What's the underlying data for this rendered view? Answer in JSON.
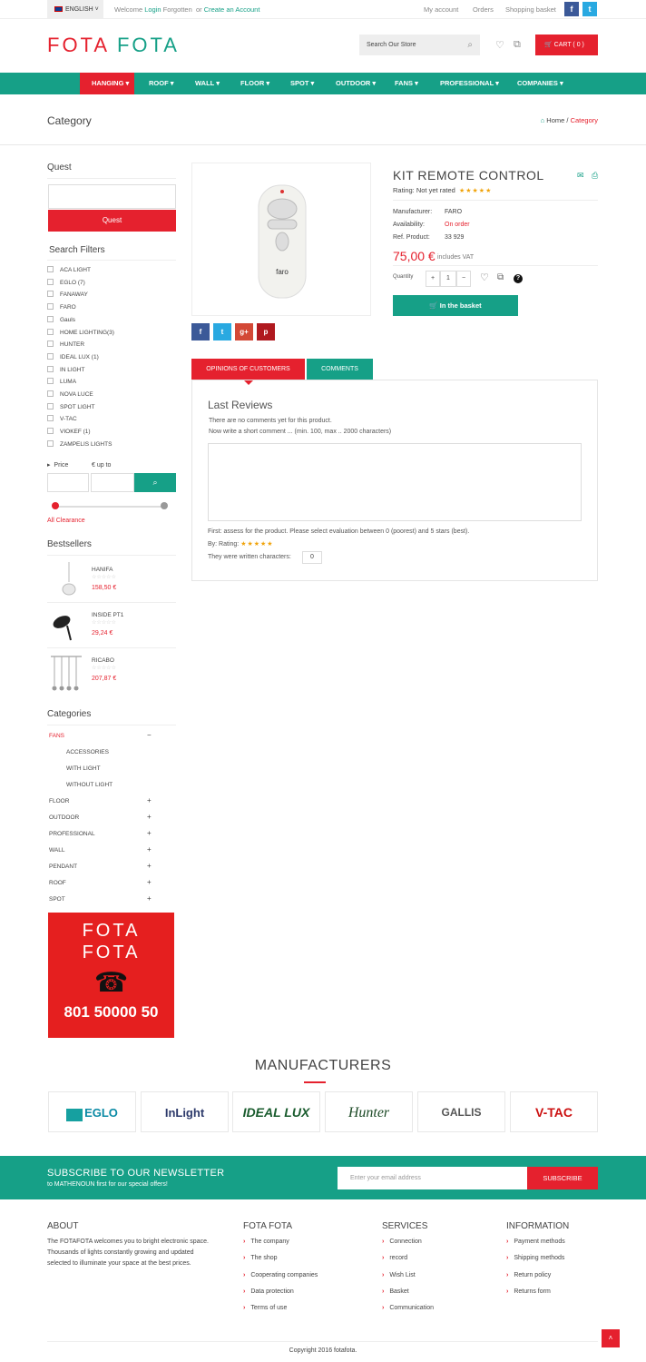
{
  "topbar": {
    "language": "ENGLISH",
    "welcome": "Welcome",
    "login": "Login",
    "forgotten": "Forgotten",
    "or": "or",
    "create_account": "Create an Account",
    "my_account": "My account",
    "orders": "Orders",
    "shopping_basket": "Shopping basket"
  },
  "header": {
    "logo_part1": "FOTA",
    "logo_part2": "FOTA",
    "search_placeholder": "Search Our Store",
    "cart_label": "CART ( 0 )"
  },
  "nav": {
    "items": [
      "HANGING",
      "ROOF",
      "WALL",
      "FLOOR",
      "SPOT",
      "OUTDOOR",
      "FANS",
      "PROFESSIONAL",
      "COMPANIES"
    ]
  },
  "page": {
    "title": "Category",
    "breadcrumb_home": "Home",
    "breadcrumb_current": "Category"
  },
  "sidebar": {
    "quest_title": "Quest",
    "quest_button": "Quest",
    "filters_title": "Search Filters",
    "filters": [
      "ACA LIGHT",
      "EGLO (7)",
      "FANAWAY",
      "FARO",
      "Gauls",
      "HOME LIGHTING(3)",
      "HUNTER",
      "IDEAL LUX (1)",
      "IN LIGHT",
      "LUMA",
      "NOVA LUCE",
      "SPOT LIGHT",
      "V-TAC",
      "VIOKEF (1)",
      "ZAMPELIS LIGHTS"
    ],
    "price_label": "Price",
    "upto_label": "€  up to",
    "all_clearance": "All Clearance",
    "bestsellers_title": "Bestsellers",
    "bestsellers": [
      {
        "name": "HANIFA",
        "price": "158,50 €"
      },
      {
        "name": "INSIDE PT1",
        "price": "29,24 €"
      },
      {
        "name": "RICABO",
        "price": "207,87 €"
      }
    ],
    "categories_title": "Categories",
    "categories": [
      {
        "label": "FANS",
        "toggle": "−"
      },
      {
        "label": "ACCESSORIES",
        "toggle": ""
      },
      {
        "label": "WITH LIGHT",
        "toggle": ""
      },
      {
        "label": "WITHOUT LIGHT",
        "toggle": ""
      },
      {
        "label": "FLOOR",
        "toggle": "+"
      },
      {
        "label": "OUTDOOR",
        "toggle": "+"
      },
      {
        "label": "PROFESSIONAL",
        "toggle": "+"
      },
      {
        "label": "WALL",
        "toggle": "+"
      },
      {
        "label": "PENDANT",
        "toggle": "+"
      },
      {
        "label": "ROOF",
        "toggle": "+"
      },
      {
        "label": "SPOT",
        "toggle": "+"
      }
    ],
    "promo_line1": "FOTA",
    "promo_line2": "FOTA",
    "promo_phone": "801  50000 50"
  },
  "product": {
    "image_brand": "faro",
    "title": "KIT REMOTE CONTROL",
    "rating_text": "Rating: Not yet rated",
    "manufacturer_label": "Manufacturer:",
    "manufacturer_value": "FARO",
    "availability_label": "Availability:",
    "availability_value": "On order",
    "ref_label": "Ref. Product:",
    "ref_value": "33 929",
    "price": "75,00 €",
    "vat": "includes VAT",
    "quantity_label": "Quantity",
    "quantity_value": "1",
    "basket_button": "In the basket"
  },
  "reviews": {
    "tab_opinions": "OPINIONS OF CUSTOMERS",
    "tab_comments": "COMMENTS",
    "heading": "Last Reviews",
    "no_comments": "There are no comments yet for this product.",
    "instruction": "Now write a short comment ... (min. 100, max .. 2000 characters)",
    "assess": "First: assess for the product. Please select evaluation between 0 (poorest) and 5 stars (best).",
    "by_rating": "By: Rating:",
    "written_chars": "They were written characters:",
    "char_count": "0"
  },
  "manufacturers": {
    "title": "MANUFACTURERS",
    "logos": [
      "EGLO",
      "InLight",
      "IDEAL LUX",
      "Hunter",
      "GALLIS",
      "V-TAC"
    ]
  },
  "newsletter": {
    "title": "SUBSCRIBE TO OUR NEWSLETTER",
    "subtitle": "to MATHENOUN first for our special offers!",
    "placeholder": "Enter your email address",
    "button": "SUBSCRIBE"
  },
  "footer": {
    "about_title": "ABOUT",
    "about_text": "The FOTAFOTA welcomes you to bright electronic space. Thousands of lights constantly growing and updated selected to illuminate your space at the best prices.",
    "col2_title": "FOTA FOTA",
    "col2_links": [
      "The company",
      "The shop",
      "Cooperating companies",
      "Data protection",
      "Terms of use"
    ],
    "col3_title": "SERVICES",
    "col3_links": [
      "Connection",
      "record",
      "Wish List",
      "Basket",
      "Communication"
    ],
    "col4_title": "INFORMATION",
    "col4_links": [
      "Payment methods",
      "Shipping methods",
      "Return policy",
      "Returns form"
    ],
    "copyright": "Copyright 2016 fotafota."
  },
  "colors": {
    "teal": "#16a087",
    "red": "#e5212e"
  }
}
